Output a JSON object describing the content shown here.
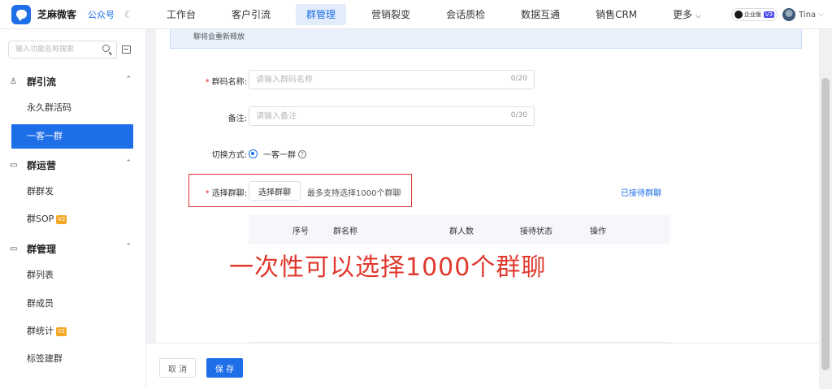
{
  "app": {
    "brand_name": "芝麻微客",
    "channel_link": "公众号",
    "moon_icon": "moon-icon"
  },
  "nav": {
    "items": [
      {
        "label": "工作台"
      },
      {
        "label": "客户引流"
      },
      {
        "label": "群管理"
      },
      {
        "label": "营销裂变"
      },
      {
        "label": "会话质检"
      },
      {
        "label": "数据互通"
      },
      {
        "label": "销售CRM"
      },
      {
        "label": "更多"
      }
    ],
    "active_index": 2,
    "more_chevron": "chevron-down-icon"
  },
  "account": {
    "edition": "企业版",
    "version": "V3",
    "user_name": "Tina"
  },
  "sidebar": {
    "search_placeholder": "输入功能名称搜索",
    "groups": [
      {
        "label": "群引流",
        "items": [
          {
            "label": "永久群活码"
          },
          {
            "label": "一客一群"
          }
        ]
      },
      {
        "label": "群运营",
        "items": [
          {
            "label": "群群发"
          },
          {
            "label": "群SOP",
            "badge": "V2"
          }
        ]
      },
      {
        "label": "群管理",
        "items": [
          {
            "label": "群列表"
          },
          {
            "label": "群成员"
          },
          {
            "label": "群统计",
            "badge": "V2"
          },
          {
            "label": "标签建群"
          }
        ]
      }
    ],
    "active_item": "一客一群"
  },
  "main": {
    "notice": "聊将会重新释放",
    "form": {
      "qr_name": {
        "label": "群码名称:",
        "placeholder": "请输入群码名称",
        "counter": "0/20"
      },
      "remark": {
        "label": "备注:",
        "placeholder": "请输入备注",
        "counter": "0/30"
      },
      "switch_mode": {
        "label": "切换方式:",
        "option": "一客一群"
      },
      "select_group": {
        "label": "选择群聊:",
        "button": "选择群聊",
        "hint": "最多支持选择1000个群聊",
        "link": "已接待群聊"
      }
    },
    "table": {
      "columns": [
        "序号",
        "群名称",
        "群人数",
        "接待状态",
        "操作"
      ]
    },
    "overlay_annotation": "一次性可以选择1000个群聊"
  },
  "footer": {
    "cancel": "取 消",
    "save": "保 存"
  }
}
